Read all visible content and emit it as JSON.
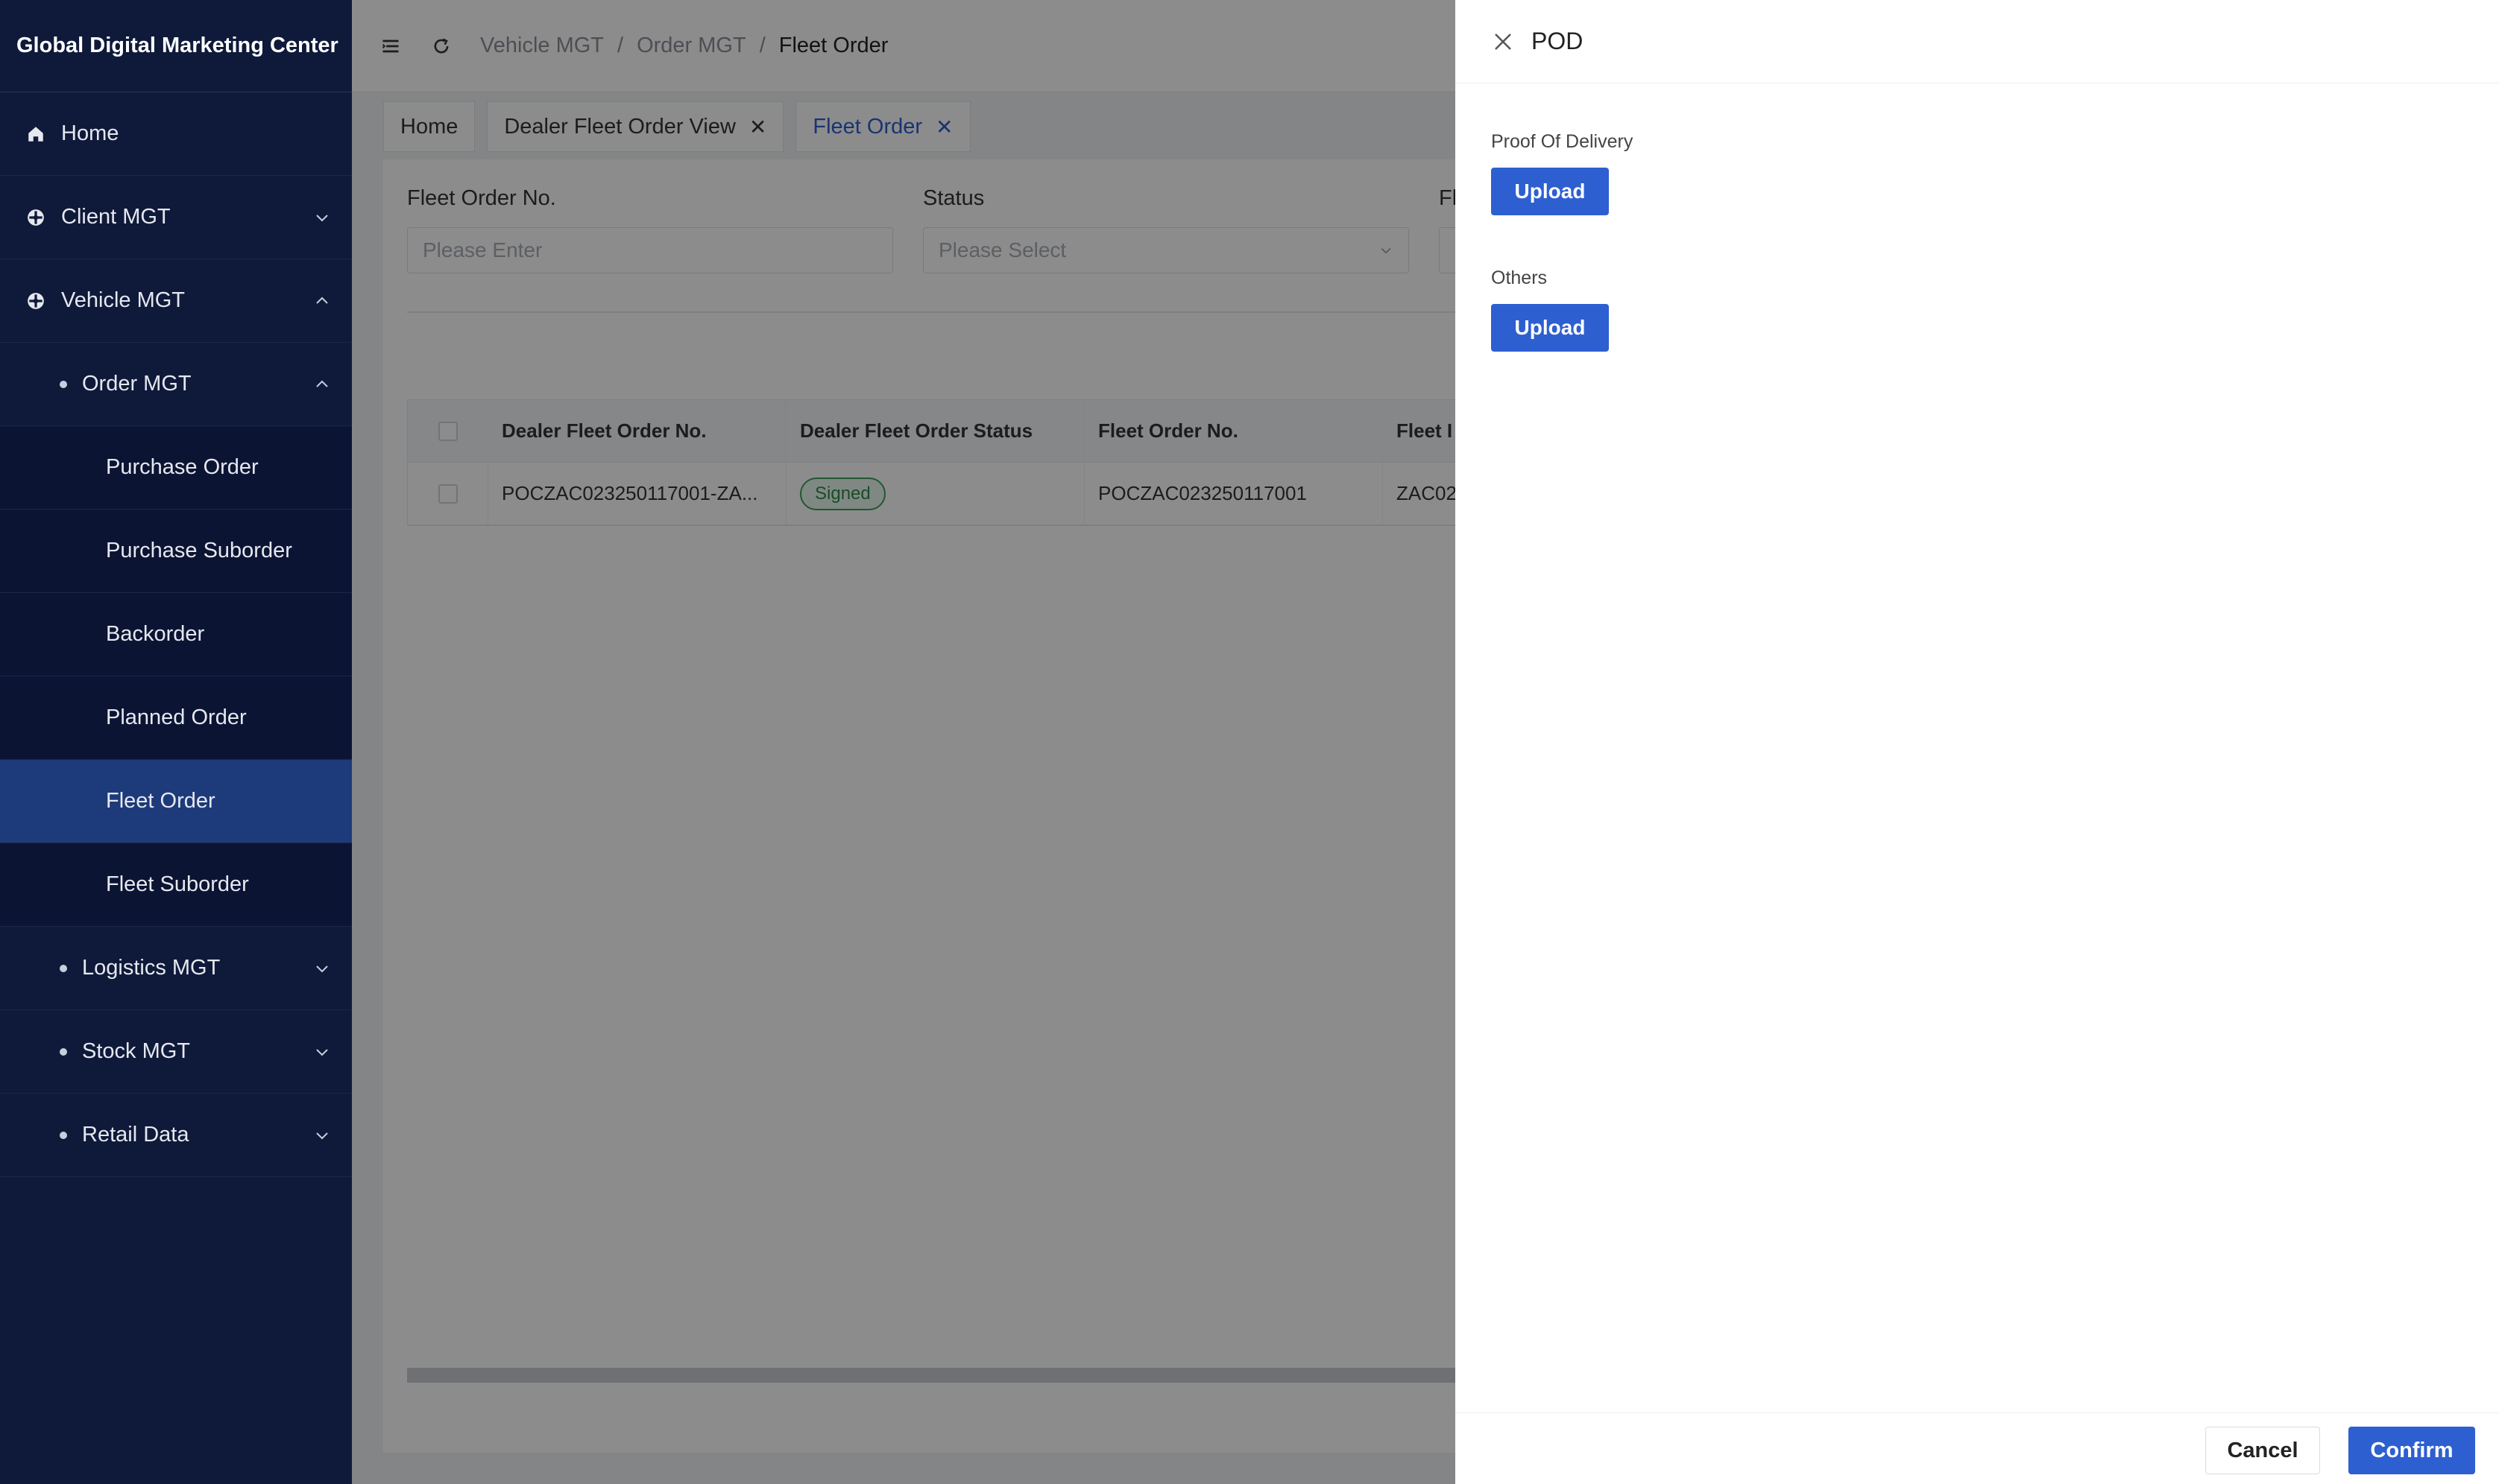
{
  "app": {
    "title": "Global Digital Marketing Center"
  },
  "sidebar": {
    "items": [
      {
        "label": "Home",
        "icon": "home-icon"
      },
      {
        "label": "Client MGT",
        "icon": "gear-icon"
      },
      {
        "label": "Vehicle MGT",
        "icon": "gear-icon"
      },
      {
        "label": "Order MGT"
      },
      {
        "label": "Purchase Order"
      },
      {
        "label": "Purchase Suborder"
      },
      {
        "label": "Backorder"
      },
      {
        "label": "Planned Order"
      },
      {
        "label": "Fleet Order"
      },
      {
        "label": "Fleet Suborder"
      },
      {
        "label": "Logistics MGT"
      },
      {
        "label": "Stock MGT"
      },
      {
        "label": "Retail Data"
      }
    ]
  },
  "breadcrumb": [
    "Vehicle MGT",
    "Order MGT",
    "Fleet Order"
  ],
  "tabs": [
    "Home",
    "Dealer Fleet Order View",
    "Fleet Order"
  ],
  "filters": {
    "fleet_order_no_label": "Fleet Order No.",
    "fleet_order_no_placeholder": "Please Enter",
    "status_label": "Status",
    "status_placeholder": "Please Select",
    "third_label_partial": "Fl"
  },
  "table": {
    "headers": [
      "Dealer Fleet Order No.",
      "Dealer Fleet Order Status",
      "Fleet Order No.",
      "Fleet I"
    ],
    "rows": [
      {
        "dealer_no": "POCZAC023250117001-ZA...",
        "status": "Signed",
        "fleet_no": "POCZAC023250117001",
        "fleet_col4": "ZAC02"
      }
    ]
  },
  "drawer": {
    "title": "POD",
    "proof_label": "Proof Of Delivery",
    "upload_label": "Upload",
    "others_label": "Others",
    "cancel_label": "Cancel",
    "confirm_label": "Confirm"
  },
  "colors": {
    "sidebar_bg": "#0f1a3a",
    "active_menu": "#1d3a7a",
    "primary": "#2d5fd0",
    "badge_green": "#3aa05a"
  }
}
